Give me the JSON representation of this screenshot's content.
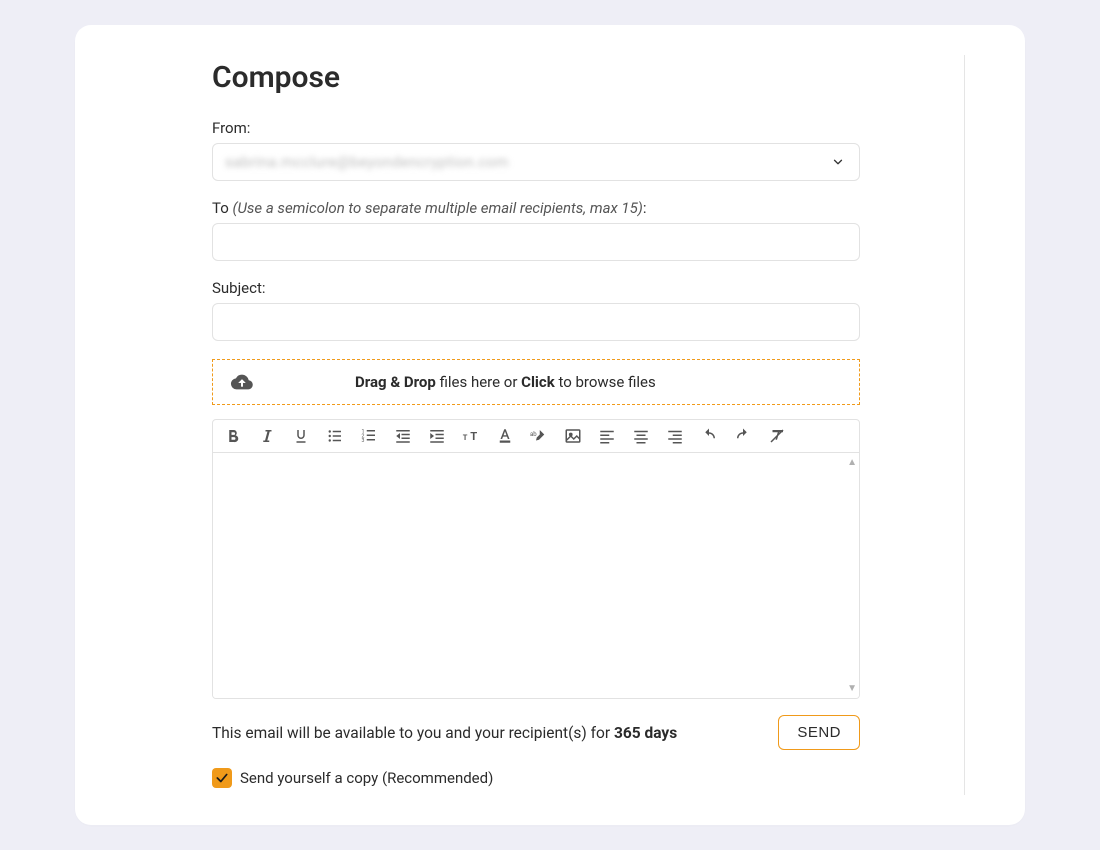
{
  "title": "Compose",
  "from": {
    "label": "From:",
    "value": "sabrina.mcclure@beyondencryption.com"
  },
  "to": {
    "label_pre": "To ",
    "hint": "(Use a semicolon to separate multiple email recipients, max 15)",
    "label_post": ":",
    "value": ""
  },
  "subject": {
    "label": "Subject:",
    "value": ""
  },
  "dropzone": {
    "bold1": "Drag & Drop",
    "text1": " files here or ",
    "bold2": "Click",
    "text2": " to browse files"
  },
  "availability": {
    "pre": "This email will be available to you and your recipient(s) for ",
    "days": "365 days"
  },
  "send_label": "SEND",
  "copy": {
    "checked": true,
    "label": "Send yourself a copy (Recommended)"
  },
  "toolbar": [
    "bold",
    "italic",
    "underline",
    "bullet-list",
    "number-list",
    "outdent",
    "indent",
    "font-size",
    "font-color",
    "highlight",
    "image",
    "align-left",
    "align-center",
    "align-right",
    "undo",
    "redo",
    "clear-format"
  ]
}
